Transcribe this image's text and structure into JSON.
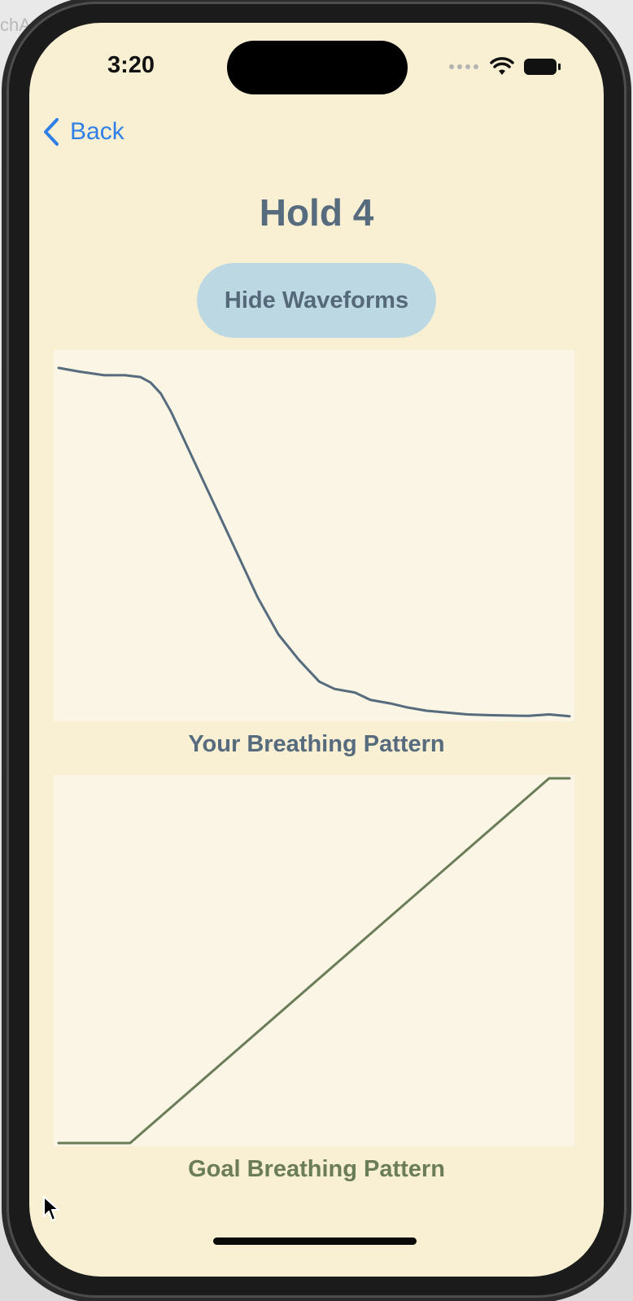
{
  "backdrop_text": "chA",
  "status_bar": {
    "time": "3:20",
    "icons": [
      "cellular-dots-icon",
      "wifi-icon",
      "battery-icon"
    ]
  },
  "nav": {
    "back_label": "Back",
    "back_icon": "chevron-left-icon"
  },
  "page": {
    "title": "Hold 4",
    "toggle_label": "Hide Waveforms"
  },
  "colors": {
    "background": "#f9f0d3",
    "chart_background": "#faf5e4",
    "user_line": "#566b7e",
    "goal_line": "#6b7d58",
    "accent_blue": "#2f7fe7",
    "button_fill": "#bcd9e3"
  },
  "chart_data": [
    {
      "type": "line",
      "title": "Your Breathing Pattern",
      "xlabel": "",
      "ylabel": "",
      "grid": false,
      "x": [
        0,
        0.04,
        0.09,
        0.13,
        0.16,
        0.18,
        0.2,
        0.22,
        0.25,
        0.28,
        0.31,
        0.35,
        0.39,
        0.43,
        0.47,
        0.51,
        0.54,
        0.58,
        0.61,
        0.65,
        0.68,
        0.72,
        0.76,
        0.8,
        0.84,
        0.88,
        0.92,
        0.96,
        1.0
      ],
      "y": [
        0.96,
        0.95,
        0.94,
        0.94,
        0.935,
        0.92,
        0.89,
        0.84,
        0.75,
        0.66,
        0.57,
        0.45,
        0.33,
        0.23,
        0.16,
        0.1,
        0.08,
        0.07,
        0.05,
        0.04,
        0.03,
        0.02,
        0.015,
        0.01,
        0.008,
        0.007,
        0.006,
        0.01,
        0.005
      ],
      "ylim": [
        0,
        1
      ]
    },
    {
      "type": "line",
      "title": "Goal Breathing Pattern",
      "xlabel": "",
      "ylabel": "",
      "grid": false,
      "x": [
        0,
        0.14,
        0.96,
        1.0
      ],
      "y": [
        0,
        0,
        1,
        1
      ],
      "ylim": [
        0,
        1
      ]
    }
  ]
}
